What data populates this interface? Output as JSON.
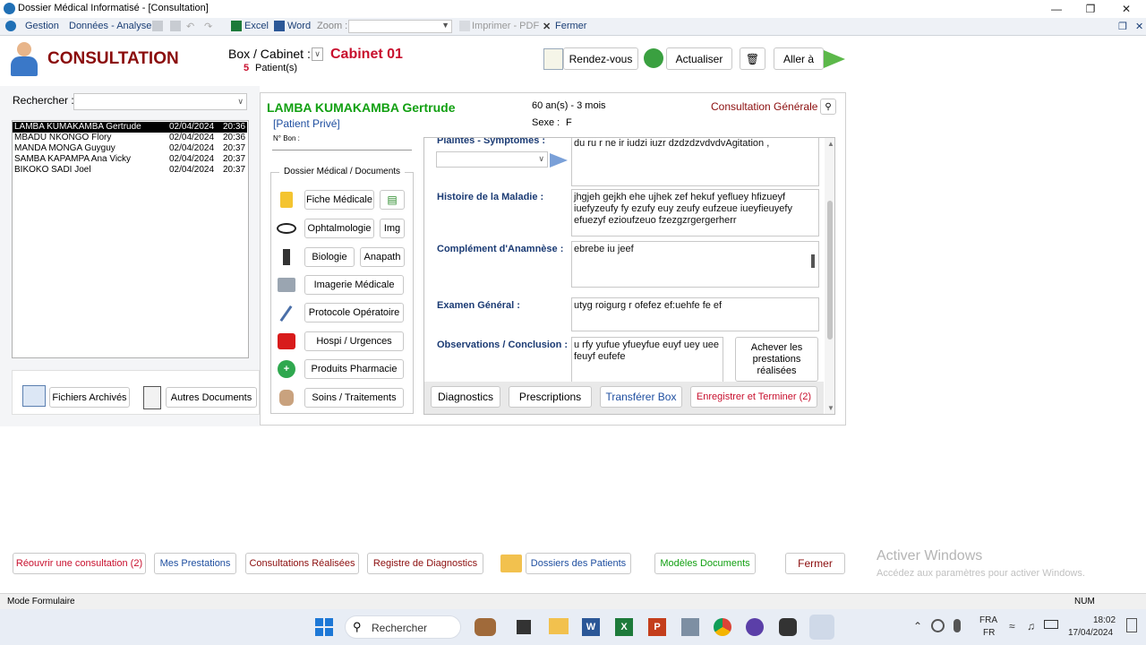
{
  "window": {
    "title": "Dossier Médical Informatisé - [Consultation]"
  },
  "menubar": {
    "gestion": "Gestion",
    "donnees": "Données - Analyse",
    "excel": "Excel",
    "word": "Word",
    "zoom_label": "Zoom :",
    "imprimer": "Imprimer - PDF",
    "fermer": "Fermer"
  },
  "header": {
    "title": "CONSULTATION",
    "box_label": "Box / Cabinet :",
    "cabinet": "Cabinet 01",
    "patient_count": "5",
    "patients_label": "Patient(s)",
    "rendezvous": "Rendez-vous",
    "actualiser": "Actualiser",
    "aller": "Aller à"
  },
  "search": {
    "label": "Rechercher :"
  },
  "patient_list": [
    {
      "name": "LAMBA KUMAKAMBA Gertrude",
      "date": "02/04/2024",
      "time": "20:36",
      "selected": true
    },
    {
      "name": "MBADU NKONGO Flory",
      "date": "02/04/2024",
      "time": "20:36",
      "selected": false
    },
    {
      "name": "MANDA MONGA Guyguy",
      "date": "02/04/2024",
      "time": "20:37",
      "selected": false
    },
    {
      "name": "SAMBA KAPAMPA Ana Vicky",
      "date": "02/04/2024",
      "time": "20:37",
      "selected": false
    },
    {
      "name": "BIKOKO SADI Joel",
      "date": "02/04/2024",
      "time": "20:37",
      "selected": false
    }
  ],
  "archives": {
    "fichiers": "Fichiers Archivés",
    "autres": "Autres Documents"
  },
  "patient": {
    "name": "LAMBA KUMAKAMBA Gertrude",
    "type": "[Patient Privé]",
    "bon_label": "N° Bon :",
    "age": "60 an(s) - 3 mois",
    "sexe_label": "Sexe :",
    "sexe": "F",
    "consultation_type": "Consultation Générale"
  },
  "dossier": {
    "title": "Dossier Médical / Documents",
    "fiche": "Fiche Médicale",
    "ophtalmo": "Ophtalmologie",
    "img": "Img",
    "biologie": "Biologie",
    "anapath": "Anapath",
    "imagerie": "Imagerie Médicale",
    "protocole": "Protocole Opératoire",
    "hospi": "Hospi / Urgences",
    "pharmacie": "Produits Pharmacie",
    "soins": "Soins / Traitements"
  },
  "form": {
    "plaintes_label": "Plaintes - Symptômes :",
    "plaintes_value": "du ru r  ne  ir iudzi iuzr dzdzdzvdvdvAgitation ,",
    "histoire_label": "Histoire de la Maladie :",
    "histoire_value": "jhgjeh gejkh ehe ujhek zef hekuf yefluey hfizueyf iuefyzeufy fy ezufy euy zeufy eufzeue iueyfieuyefy efuezyf ezioufzeuo fzezgzrgergerherr",
    "complement_label": "Complément d'Anamnèse :",
    "complement_value": "ebrebe iu jeef",
    "examen_label": "Examen Général :",
    "examen_value": "utyg roigurg r ofefez ef:uehfe fe ef",
    "observations_label": "Observations / Conclusion :",
    "observations_value": "u rfy yufue yfueyfue euyf uey uee feuyf eufefe",
    "achever": "Achever les prestations réalisées"
  },
  "actions": {
    "diagnostics": "Diagnostics",
    "prescriptions": "Prescriptions",
    "transferer": "Transférer Box",
    "enregistrer": "Enregistrer et Terminer (2)"
  },
  "bottom": {
    "reouvrir": "Réouvrir une consultation (2)",
    "prestations": "Mes Prestations",
    "realisees": "Consultations Réalisées",
    "registre": "Registre de Diagnostics",
    "dossiers": "Dossiers des Patients",
    "modeles": "Modèles Documents",
    "fermer": "Fermer"
  },
  "watermark": {
    "title": "Activer Windows",
    "subtitle": "Accédez aux paramètres pour activer Windows."
  },
  "status": {
    "mode": "Mode Formulaire",
    "num": "NUM"
  },
  "taskbar": {
    "search": "Rechercher",
    "lang1": "FRA",
    "lang2": "FR",
    "time": "18:02",
    "date": "17/04/2024"
  },
  "colors": {
    "title_red": "#8b0d0d",
    "patient_green": "#12a012",
    "label_blue": "#1b3b74",
    "action_red": "#c8102e"
  }
}
